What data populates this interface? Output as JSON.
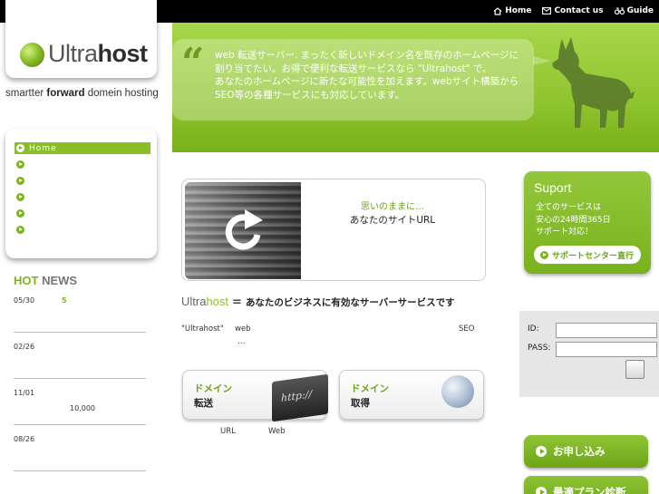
{
  "topnav": {
    "home": "Home",
    "contact": "Contact us",
    "guide": "Guide"
  },
  "logo": {
    "name_a": "Ultra",
    "name_b": "host"
  },
  "tagline": {
    "a": "smartter ",
    "b": "forward",
    "c": " domein hosting"
  },
  "bubble": {
    "lines": [
      "web 転送サーバー. まったく新しいドメイン名を既存のホームページに",
      "割り当てたい。お得で便利な転送サービスなら \"Ultrahost\" で。",
      "あなたのホームページに新たな可能性を加えます。webサイト構築から",
      "SEO等の各種サービスにも対応しています。"
    ]
  },
  "menu": {
    "active_label": "Home"
  },
  "news": {
    "title_hot": "HOT",
    "title_news": " NEWS",
    "items": [
      {
        "date": "05/30",
        "value": "5"
      },
      {
        "date": "02/26",
        "value": ""
      },
      {
        "date": "11/01",
        "value": "10,000"
      },
      {
        "date": "08/26",
        "value": ""
      }
    ]
  },
  "feature": {
    "green": "思いのままに…",
    "black": "あなたのサイトURL"
  },
  "main_heading": {
    "ultra": "Ultra",
    "host": "host",
    "eq": "=",
    "text": "あなたのビジネスに有効なサーバーサービスです"
  },
  "body_text": {
    "a": "\"Ultrahost\"",
    "b": "web",
    "c": "SEO",
    "d": "…",
    "e": "URL",
    "f": "Web"
  },
  "domain_transfer": {
    "l1": "ドメイン",
    "l2": "転送",
    "img": "http://"
  },
  "domain_acquire": {
    "l1": "ドメイン",
    "l2": "取得"
  },
  "support": {
    "title": "Suport",
    "lines": [
      "全てのサービスは",
      "安心の24時間365日",
      "サポート対応！"
    ],
    "button": "サポートセンター直行"
  },
  "login": {
    "id_label": "ID:",
    "pass_label": "PASS:"
  },
  "right_buttons": {
    "apply": "お申し込み",
    "plan": "最適プラン診断"
  },
  "colors": {
    "accent_green": "#7cb41f",
    "topbar": "#000000"
  }
}
